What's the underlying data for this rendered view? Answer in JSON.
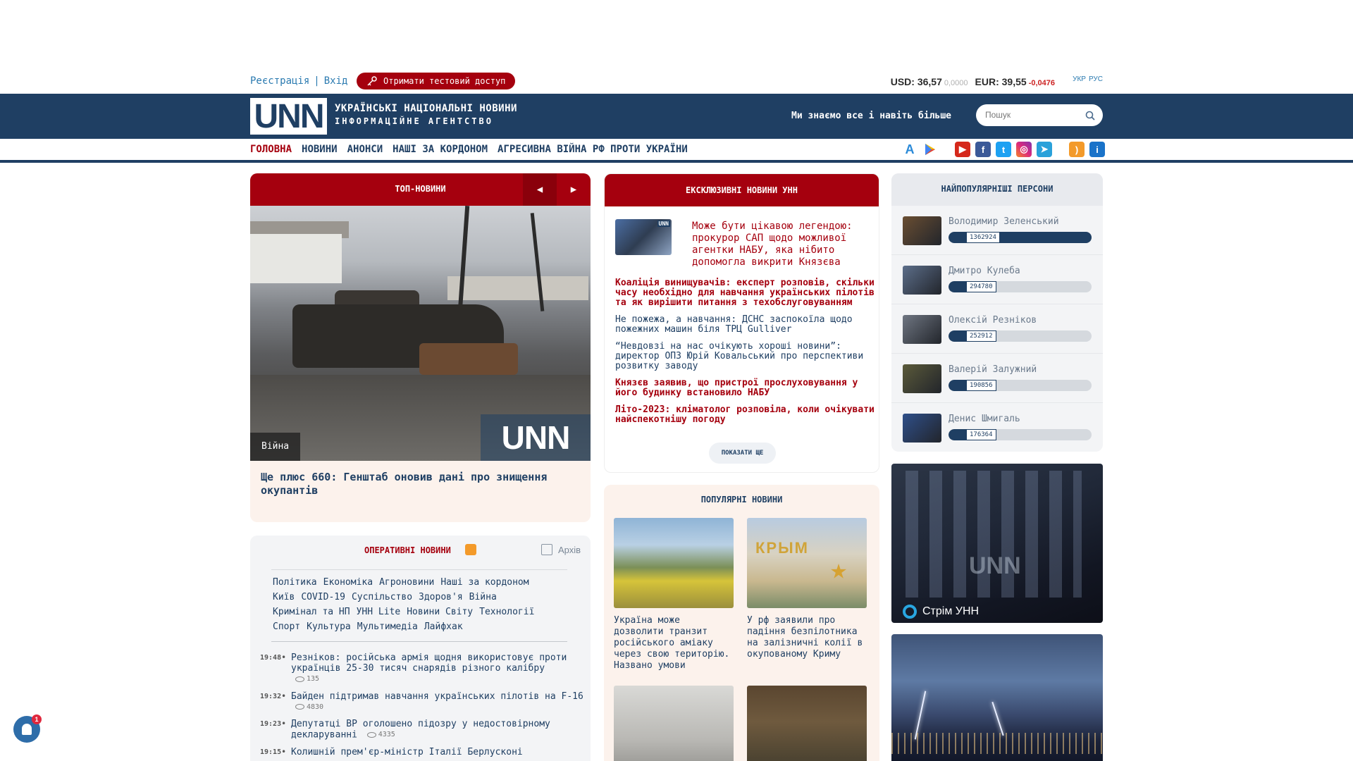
{
  "auth": {
    "register": "Реєстрація",
    "separator": "|",
    "login": "Вхід"
  },
  "trial_button": "Отримати тестовий доступ",
  "rates": {
    "usd": "USD: 36,57",
    "usd_delta": "0,0000",
    "eur": "EUR: 39,55",
    "eur_delta": "-0,0476"
  },
  "langs": [
    "УКР",
    "РУС"
  ],
  "header": {
    "logo": "UNN",
    "brand_line1": "УКРАЇНСЬКІ НАЦІОНАЛЬНІ НОВИНИ",
    "brand_line2": "ІНФОРМАЦІЙНЕ АГЕНТСТВО",
    "slogan": "Ми знаємо все і навіть більше",
    "search_placeholder": "Пошук"
  },
  "nav": [
    "ГОЛОВНА",
    "НОВИНИ",
    "АНОНСИ",
    "НАШІ ЗА КОРДОНОМ",
    "АГРЕСИВНА ВІЙНА РФ ПРОТИ УКРАЇНИ"
  ],
  "social_icons": [
    "app-store-icon",
    "google-play-icon",
    "youtube-icon",
    "facebook-icon",
    "twitter-icon",
    "instagram-icon",
    "telegram-icon",
    "rss-icon",
    "info-icon"
  ],
  "top_news": {
    "title": "ТОП-НОВИНИ",
    "tag": "Війна",
    "watermark": "UNN",
    "headline": "Ще плюс 660: Генштаб оновив дані про знищення окупантів"
  },
  "operative": {
    "title": "ОПЕРАТИВНІ НОВИНИ",
    "archive": "Архів",
    "categories": [
      [
        "Політика",
        "Економіка",
        "Агроновини",
        "Наші за кордоном"
      ],
      [
        "Київ",
        "COVID-19",
        "Суспільство",
        "Здоров'я",
        "Війна"
      ],
      [
        "Кримінал та НП",
        "УНН Lite",
        "Новини Світу",
        "Технології"
      ],
      [
        "Спорт",
        "Культура",
        "Мультимедіа",
        "Лайфхак"
      ]
    ],
    "news": [
      {
        "time": "19:48",
        "text": "Резніков: російська армія щодня використовує проти українців 25-30 тисяч снарядів різного калібру",
        "views": "135"
      },
      {
        "time": "19:32",
        "text": "Байден підтримав навчання українських пілотів на F-16",
        "views": "4830"
      },
      {
        "time": "19:23",
        "text": "Депутатці ВР оголошено підозру у недостовірному декларуванні",
        "views": "4335"
      },
      {
        "time": "19:15",
        "text": "Колишній прем'єр-міністр Італії Берлусконі",
        "views": ""
      }
    ]
  },
  "exclusive": {
    "title": "ЕКСКЛЮЗИВНІ НОВИНИ УНН",
    "thumb_watermark": "UNN",
    "lead": "Може бути цікавою легендою: прокурор САП щодо можливої агентки НАБУ, яка нібито допомогла викрити Князєва",
    "items": [
      {
        "text": "Коаліція винищувачів: експерт розповів, скільки часу необхідно для навчання українських пілотів та як вирішити питання з техобслуговуванням",
        "style": "red"
      },
      {
        "text": "Не пожежа, а навчання: ДСНС заспокоїла щодо пожежних машин біля ТРЦ Gulliver",
        "style": "blue"
      },
      {
        "text": "“Невдовзі на нас очікують хороші новини”: директор ОПЗ Юрій Ковальський про перспективи розвитку заводу",
        "style": "blue"
      },
      {
        "text": "Князєв заявив, що пристрої прослуховування у його будинку встановило НАБУ",
        "style": "red"
      },
      {
        "text": "Літо-2023: кліматолог розповіла, коли очікувати найспекотнішу погоду",
        "style": "red"
      }
    ],
    "more_button": "ПОКАЗАТИ ЩЕ"
  },
  "popular": {
    "title": "ПОПУЛЯРНІ НОВИНИ",
    "items": [
      {
        "caption": "Україна може дозволити транзит російського аміаку через свою територію. Названо умови"
      },
      {
        "caption": "У рф заявили про падіння безпілотника на залізничні колії в окупованому Криму",
        "sign": "КРЫМ"
      },
      {
        "caption": ""
      },
      {
        "caption": ""
      }
    ]
  },
  "persons": {
    "title": "НАЙПОПУЛЯРНІШІ ПЕРСОНИ",
    "items": [
      {
        "name": "Володимир Зеленський",
        "count": "1362924",
        "share": 1.0,
        "color": "#6a4e32"
      },
      {
        "name": "Дмитро Кулеба",
        "count": "294780",
        "share": 0.22,
        "color": "#5c6e8a"
      },
      {
        "name": "Олексій Резніков",
        "count": "252912",
        "share": 0.19,
        "color": "#6f7682"
      },
      {
        "name": "Валерій Залужний",
        "count": "190856",
        "share": 0.14,
        "color": "#5b5a3a"
      },
      {
        "name": "Денис Шмигаль",
        "count": "176364",
        "share": 0.13,
        "color": "#2f4f8a"
      }
    ]
  },
  "stream": {
    "label": "Стрім УНН",
    "watermark": "UNN"
  },
  "notifications": {
    "badge": "1"
  }
}
